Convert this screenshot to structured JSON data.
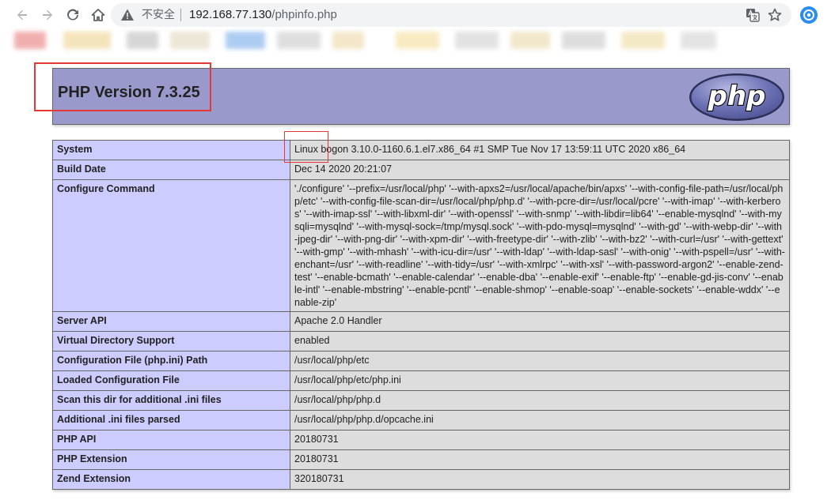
{
  "browser": {
    "security_label": "不安全",
    "url_host": "192.168.77.130",
    "url_path": "/phpinfo.php"
  },
  "page": {
    "title": "PHP Version 7.3.25",
    "logo_text": "php"
  },
  "info_rows": [
    {
      "label": "System",
      "value": "Linux bogon 3.10.0-1160.6.1.el7.x86_64 #1 SMP Tue Nov 17 13:59:11 UTC 2020 x86_64"
    },
    {
      "label": "Build Date",
      "value": "Dec 14 2020 20:21:07"
    },
    {
      "label": "Configure Command",
      "value": "'./configure' '--prefix=/usr/local/php' '--with-apxs2=/usr/local/apache/bin/apxs' '--with-config-file-path=/usr/local/php/etc' '--with-config-file-scan-dir=/usr/local/php/php.d' '--with-pcre-dir=/usr/local/pcre' '--with-imap' '--with-kerberos' '--with-imap-ssl' '--with-libxml-dir' '--with-openssl' '--with-snmp' '--with-libdir=lib64' '--enable-mysqlnd' '--with-mysqli=mysqlnd' '--with-mysql-sock=/tmp/mysql.sock' '--with-pdo-mysql=mysqlnd' '--with-gd' '--with-webp-dir' '--with-jpeg-dir' '--with-png-dir' '--with-xpm-dir' '--with-freetype-dir' '--with-zlib' '--with-bz2' '--with-curl=/usr' '--with-gettext' '--with-gmp' '--with-mhash' '--with-icu-dir=/usr' '--with-ldap' '--with-ldap-sasl' '--with-onig' '--with-pspell=/usr' '--with-enchant=/usr' '--with-readline' '--with-tidy=/usr' '--with-xmlrpc' '--with-xsl' '--with-password-argon2' '--enable-zend-test' '--enable-bcmath' '--enable-calendar' '--enable-dba' '--enable-exif' '--enable-ftp' '--enable-gd-jis-conv' '--enable-intl' '--enable-mbstring' '--enable-pcntl' '--enable-shmop' '--enable-soap' '--enable-sockets' '--enable-wddx' '--enable-zip'"
    },
    {
      "label": "Server API",
      "value": "Apache 2.0 Handler"
    },
    {
      "label": "Virtual Directory Support",
      "value": "enabled"
    },
    {
      "label": "Configuration File (php.ini) Path",
      "value": "/usr/local/php/etc"
    },
    {
      "label": "Loaded Configuration File",
      "value": "/usr/local/php/etc/php.ini"
    },
    {
      "label": "Scan this dir for additional .ini files",
      "value": "/usr/local/php/php.d"
    },
    {
      "label": "Additional .ini files parsed",
      "value": "/usr/local/php/php.d/opcache.ini"
    },
    {
      "label": "PHP API",
      "value": "20180731"
    },
    {
      "label": "PHP Extension",
      "value": "20180731"
    },
    {
      "label": "Zend Extension",
      "value": "320180731"
    }
  ],
  "colors": {
    "header_bg": "#9999cc",
    "label_bg": "#ccccff",
    "value_bg": "#dddddd",
    "annotation": "#e53935"
  }
}
